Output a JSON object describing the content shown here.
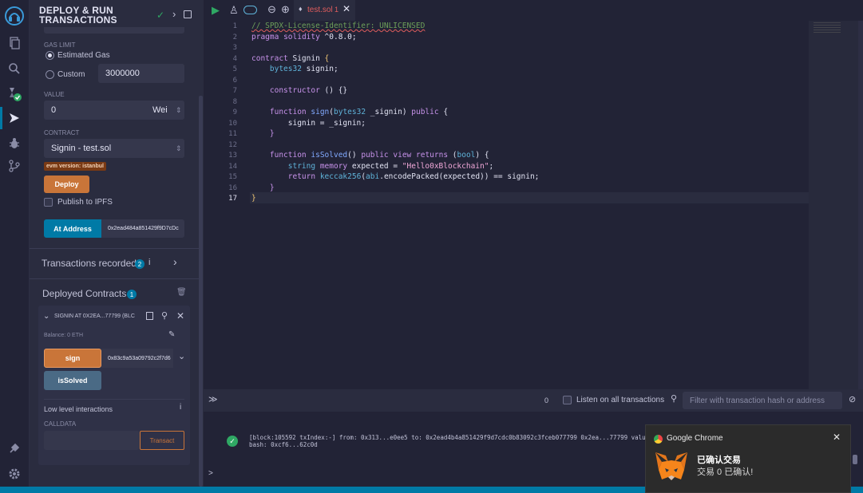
{
  "sidebar": {
    "title_line1": "DEPLOY & RUN",
    "title_line2": "TRANSACTIONS"
  },
  "deploy": {
    "gas_limit_label": "GAS LIMIT",
    "estimated_gas_label": "Estimated Gas",
    "custom_label": "Custom",
    "custom_gas_value": "3000000",
    "value_label": "VALUE",
    "value_amount": "0",
    "value_unit": "Wei",
    "contract_label": "CONTRACT",
    "contract_selected": "Signin - test.sol",
    "evm_badge": "evm version: istanbul",
    "deploy_button": "Deploy",
    "publish_ipfs_label": "Publish to IPFS",
    "at_address_button": "At Address",
    "at_address_value": "0x2ead484a851429f9D7cDc"
  },
  "transactions": {
    "label": "Transactions recorded",
    "count": "2"
  },
  "deployed": {
    "label": "Deployed Contracts",
    "count": "1",
    "instance_title": "SIGNIN AT 0X2EA...77799 (BLC",
    "balance": "Balance: 0 ETH",
    "sign_button": "sign",
    "sign_input": "0x83c9a53a09792c2f7d6",
    "issolved_button": "isSolved",
    "low_level_label": "Low level interactions",
    "calldata_label": "CALLDATA",
    "transact_button": "Transact"
  },
  "editor": {
    "tab_name": "test.sol",
    "tab_count": "1",
    "line_numbers": [
      "1",
      "2",
      "3",
      "4",
      "5",
      "6",
      "7",
      "8",
      "9",
      "10",
      "11",
      "12",
      "13",
      "14",
      "15",
      "16",
      "17"
    ]
  },
  "terminal": {
    "count": "0",
    "listen_label": "Listen on all transactions",
    "filter_placeholder": "Filter with transaction hash or address",
    "log_line1": "[block:105592 txIndex:-] from: 0x313...e0ee5 to: 0x2ead4b4a851429f9d7cdc0b83092c3fceb077799 0x2ea...77799 value:",
    "log_line2": "bash: 0xcf6...62c0d",
    "prompt": ">"
  },
  "notification": {
    "app": "Google Chrome",
    "title": "已确认交易",
    "body": "交易 0 已确认!"
  }
}
